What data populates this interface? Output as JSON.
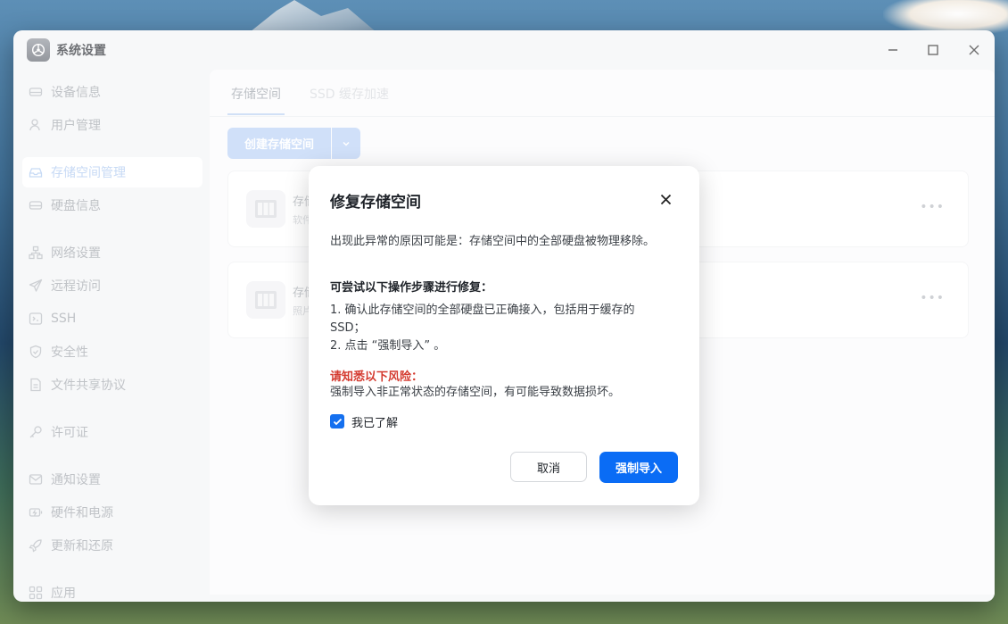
{
  "window": {
    "title": "系统设置"
  },
  "sidebar": {
    "items": [
      {
        "label": "设备信息",
        "icon": "drive-icon",
        "active": false
      },
      {
        "label": "用户管理",
        "icon": "user-icon",
        "active": false
      },
      {
        "label": "存储空间管理",
        "icon": "storage-icon",
        "active": true
      },
      {
        "label": "硬盘信息",
        "icon": "disk-icon",
        "active": false
      },
      {
        "label": "网络设置",
        "icon": "network-icon",
        "active": false
      },
      {
        "label": "远程访问",
        "icon": "send-icon",
        "active": false
      },
      {
        "label": "SSH",
        "icon": "terminal-icon",
        "active": false
      },
      {
        "label": "安全性",
        "icon": "shield-icon",
        "active": false
      },
      {
        "label": "文件共享协议",
        "icon": "file-icon",
        "active": false
      },
      {
        "label": "许可证",
        "icon": "key-icon",
        "active": false
      },
      {
        "label": "通知设置",
        "icon": "mail-icon",
        "active": false
      },
      {
        "label": "硬件和电源",
        "icon": "battery-icon",
        "active": false
      },
      {
        "label": "更新和还原",
        "icon": "rocket-icon",
        "active": false
      },
      {
        "label": "应用",
        "icon": "grid-icon",
        "active": false
      }
    ]
  },
  "main": {
    "tabs": [
      {
        "label": "存储空间",
        "active": true
      },
      {
        "label": "SSD 缓存加速",
        "active": false
      }
    ],
    "create_button": "创建存储空间",
    "cards": [
      {
        "title": "存储",
        "subtitle": "软件"
      },
      {
        "title": "存储",
        "subtitle": "照片"
      }
    ]
  },
  "dialog": {
    "title": "修复存储空间",
    "reason": "出现此异常的原因可能是：存储空间中的全部硬盘被物理移除。",
    "steps_heading": "可尝试以下操作步骤进行修复：",
    "step1": "1. 确认此存储空间的全部硬盘已正确接入，包括用于缓存的 SSD；",
    "step2": "2. 点击 “强制导入” 。",
    "risk_heading": "请知悉以下风险：",
    "risk_text": "强制导入非正常状态的存储空间，有可能导致数据损坏。",
    "checkbox_label": "我已了解",
    "checkbox_checked": true,
    "cancel_label": "取消",
    "confirm_label": "强制导入"
  },
  "colors": {
    "accent": "#0a6cf5",
    "danger": "#d43a2f"
  }
}
